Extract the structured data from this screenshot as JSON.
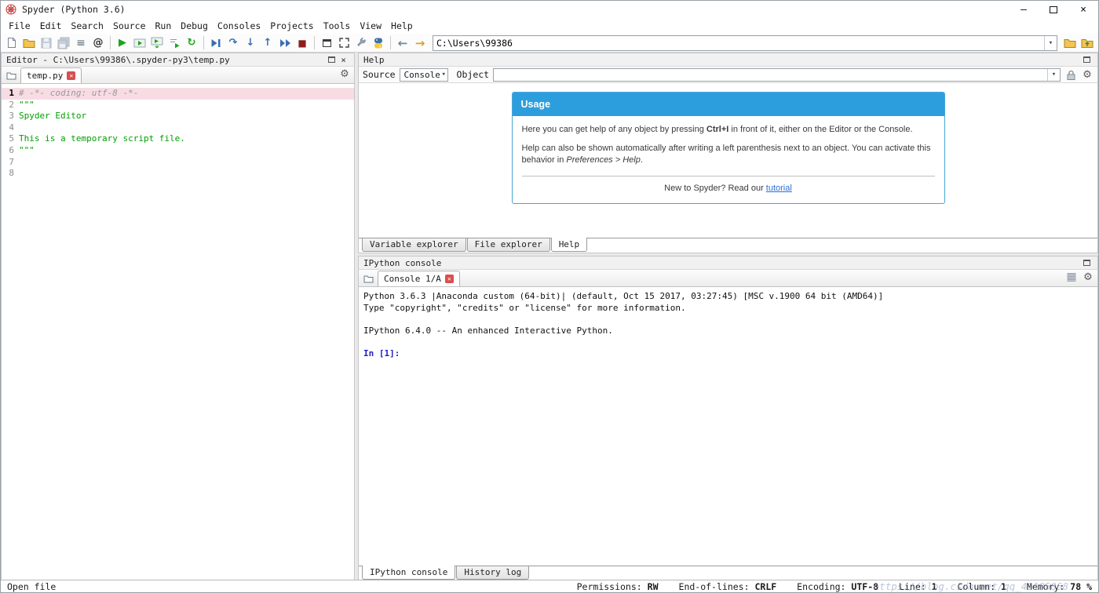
{
  "window": {
    "title": "Spyder (Python 3.6)"
  },
  "menus": [
    "File",
    "Edit",
    "Search",
    "Source",
    "Run",
    "Debug",
    "Consoles",
    "Projects",
    "Tools",
    "View",
    "Help"
  ],
  "toolbar": {
    "path_value": "C:\\Users\\99386",
    "icons": [
      "new-file",
      "open-file",
      "save",
      "save-all",
      "file-switcher",
      "find-symbols",
      "run",
      "run-cell",
      "run-cell-advance",
      "run-selection",
      "rerun-last-cell",
      "debug",
      "step-over",
      "step-into",
      "step-out",
      "continue",
      "stop",
      "maximize-pane",
      "fullscreen",
      "preferences",
      "python-path",
      "back",
      "forward",
      "browse-directory",
      "parent-directory"
    ]
  },
  "editor": {
    "panel_title": "Editor - C:\\Users\\99386\\.spyder-py3\\temp.py",
    "tab": "temp.py",
    "lines": [
      {
        "num": "1",
        "text": "# -*- coding: utf-8 -*-"
      },
      {
        "num": "2",
        "text": "\"\"\""
      },
      {
        "num": "3",
        "text": "Spyder Editor"
      },
      {
        "num": "4",
        "text": ""
      },
      {
        "num": "5",
        "text": "This is a temporary script file."
      },
      {
        "num": "6",
        "text": "\"\"\""
      },
      {
        "num": "7",
        "text": ""
      },
      {
        "num": "8",
        "text": ""
      }
    ]
  },
  "help": {
    "panel_title": "Help",
    "source_label": "Source",
    "source_value": "Console",
    "object_label": "Object",
    "usage": {
      "title": "Usage",
      "para1_pre": "Here you can get help of any object by pressing ",
      "para1_bold": "Ctrl+I",
      "para1_post": " in front of it, either on the Editor or the Console.",
      "para2_pre": "Help can also be shown automatically after writing a left parenthesis next to an object. You can activate this behavior in ",
      "para2_italic": "Preferences > Help",
      "para2_post": ".",
      "footer_pre": "New to Spyder? Read our ",
      "footer_link": "tutorial"
    },
    "tabs": [
      "Variable explorer",
      "File explorer",
      "Help"
    ],
    "active_tab": "Help"
  },
  "console": {
    "panel_title": "IPython console",
    "tab": "Console 1/A",
    "lines": [
      "Python 3.6.3 |Anaconda custom (64-bit)| (default, Oct 15 2017, 03:27:45) [MSC v.1900 64 bit (AMD64)]",
      "Type \"copyright\", \"credits\" or \"license\" for more information.",
      "",
      "IPython 6.4.0 -- An enhanced Interactive Python.",
      ""
    ],
    "prompt": "In [1]:",
    "tabs": [
      "IPython console",
      "History log"
    ],
    "active_tab": "IPython console"
  },
  "statusbar": {
    "message": "Open file",
    "permissions_label": "Permissions:",
    "permissions_value": "RW",
    "eol_label": "End-of-lines:",
    "eol_value": "CRLF",
    "encoding_label": "Encoding:",
    "encoding_value": "UTF-8",
    "line_label": "Line:",
    "line_value": "1",
    "column_label": "Column:",
    "column_value": "1",
    "memory_label": "Memory:",
    "memory_value": "78 %"
  },
  "watermark": "https://blog.csdn.net/qq_41185868",
  "colors": {
    "accent_blue": "#2d9edd",
    "string_green": "#00a000",
    "comment_gray": "#999999",
    "line_highlight": "#f7dce4",
    "link_blue": "#2a6fdb",
    "prompt_blue": "#2020c0",
    "run_green": "#1fa31f",
    "debug_blue": "#3b6fb5"
  }
}
